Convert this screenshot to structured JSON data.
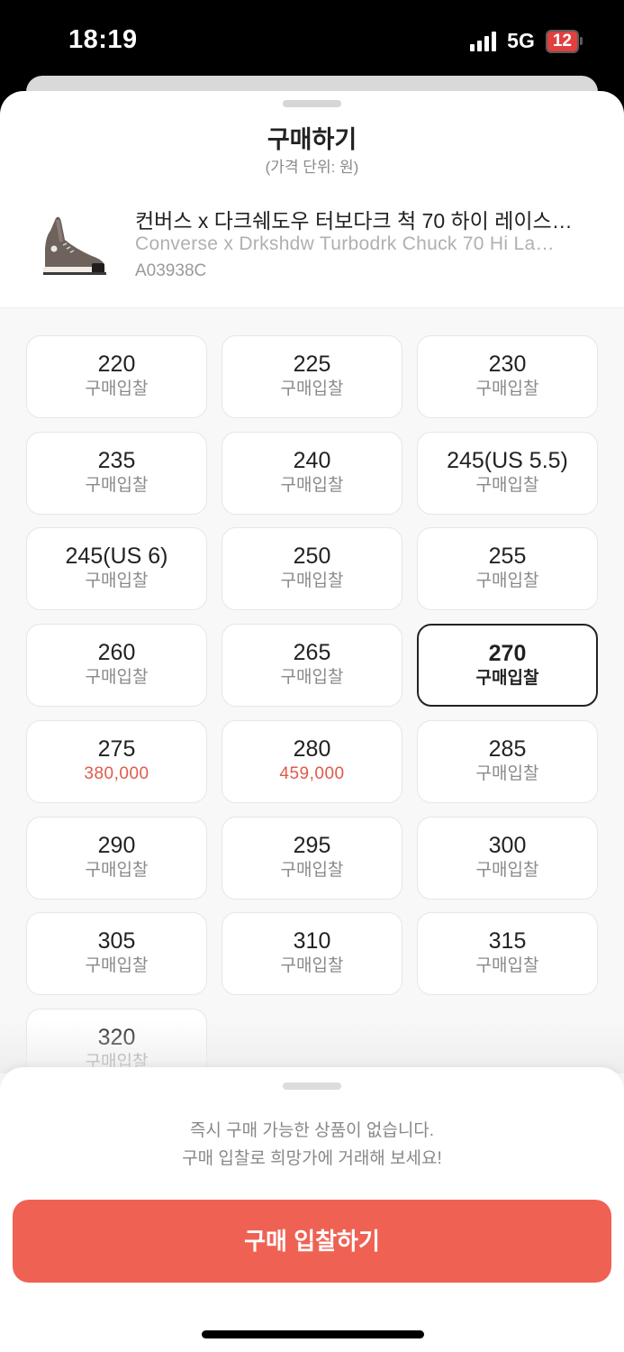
{
  "status": {
    "time": "18:19",
    "network": "5G",
    "battery": "12"
  },
  "sheet": {
    "title": "구매하기",
    "subtitle": "(가격 단위: 원)"
  },
  "product": {
    "name": "컨버스 x 다크쉐도우 터보다크 척 70 하이 레이스…",
    "name_en": "Converse x Drkshdw Turbodrk Chuck 70 Hi La…",
    "code": "A03938C"
  },
  "sizes": [
    {
      "label": "220",
      "sub": "구매입찰"
    },
    {
      "label": "225",
      "sub": "구매입찰"
    },
    {
      "label": "230",
      "sub": "구매입찰"
    },
    {
      "label": "235",
      "sub": "구매입찰"
    },
    {
      "label": "240",
      "sub": "구매입찰"
    },
    {
      "label": "245(US 5.5)",
      "sub": "구매입찰"
    },
    {
      "label": "245(US 6)",
      "sub": "구매입찰"
    },
    {
      "label": "250",
      "sub": "구매입찰"
    },
    {
      "label": "255",
      "sub": "구매입찰"
    },
    {
      "label": "260",
      "sub": "구매입찰"
    },
    {
      "label": "265",
      "sub": "구매입찰"
    },
    {
      "label": "270",
      "sub": "구매입찰",
      "selected": true
    },
    {
      "label": "275",
      "sub": "380,000",
      "price": true
    },
    {
      "label": "280",
      "sub": "459,000",
      "price": true
    },
    {
      "label": "285",
      "sub": "구매입찰"
    },
    {
      "label": "290",
      "sub": "구매입찰"
    },
    {
      "label": "295",
      "sub": "구매입찰"
    },
    {
      "label": "300",
      "sub": "구매입찰"
    },
    {
      "label": "305",
      "sub": "구매입찰"
    },
    {
      "label": "310",
      "sub": "구매입찰"
    },
    {
      "label": "315",
      "sub": "구매입찰"
    },
    {
      "label": "320",
      "sub": "구매입찰"
    }
  ],
  "bottom": {
    "notice_line1": "즉시 구매 가능한 상품이 없습니다.",
    "notice_line2": "구매 입찰로 희망가에 거래해 보세요!",
    "button_label": "구매 입찰하기"
  },
  "colors": {
    "accent": "#ef6253",
    "price": "#e05a4a",
    "battery": "#e23f3f"
  }
}
